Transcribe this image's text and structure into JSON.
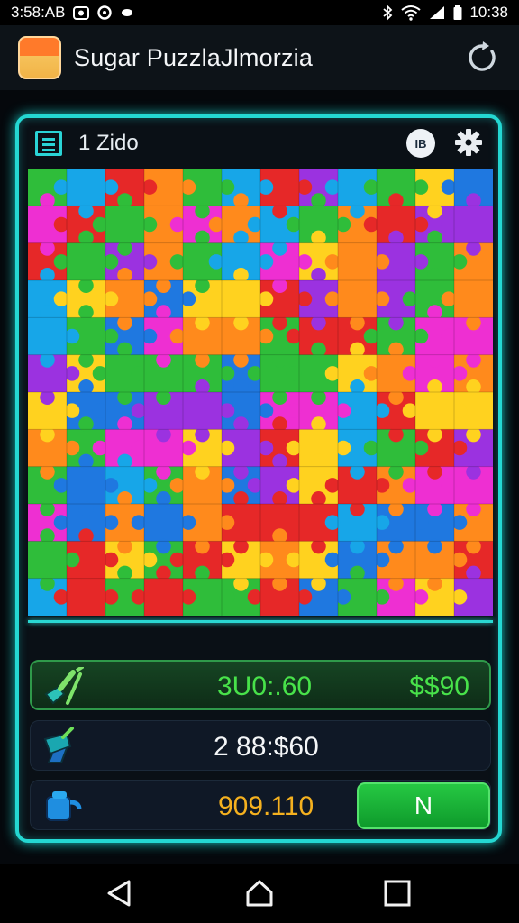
{
  "status_bar": {
    "left_text": "3:58:AB",
    "time": "10:38"
  },
  "app_bar": {
    "title": "Sugar PuzzlaJlmorzia",
    "refresh_icon": "refresh-icon"
  },
  "panel": {
    "level_title": "1 Zido",
    "badge_text": "IB",
    "menu_icon": "menu-icon",
    "settings_icon": "gear-icon"
  },
  "puzzle": {
    "cols": 12,
    "rows": 12,
    "palette": [
      "#e62828",
      "#ff8a1c",
      "#ffd21f",
      "#2fbd3a",
      "#17a6e8",
      "#ee2fd2",
      "#1f78e0",
      "#9b32e0"
    ]
  },
  "rows": [
    {
      "icon": "wrench-icon",
      "center_value": "3U0:.60",
      "right_value": "$$90"
    },
    {
      "icon": "hammer-icon",
      "center_value": "2 88:$60"
    },
    {
      "icon": "bucket-icon",
      "center_value": "909.110",
      "button_label": "N"
    }
  ]
}
